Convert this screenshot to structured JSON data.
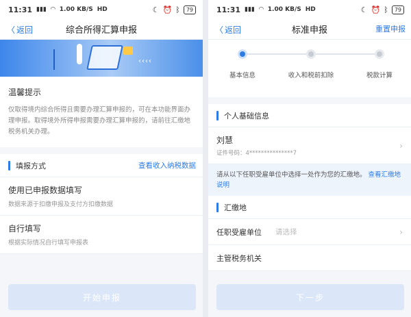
{
  "status": {
    "time": "11:31",
    "speed": "1.00\nKB/S",
    "hd": "HD",
    "battery": "79"
  },
  "left": {
    "back_label": "返回",
    "title": "综合所得汇算申报",
    "tips_title": "温馨提示",
    "tips_body": "仅取得境内综合所得且需要办理汇算申报的，可在本功能界面办理申报。取得境外所得申报需要办理汇算申报的，请前往汇缴地税务机关办理。",
    "section_label": "填报方式",
    "section_link": "查看收入纳税数据",
    "options": [
      {
        "title": "使用已申报数据填写",
        "sub": "数据来源于扣缴申报及支付方扣缴数据"
      },
      {
        "title": "自行填写",
        "sub": "根据实际情况自行填写申报表"
      }
    ],
    "button": "开始申报"
  },
  "right": {
    "back_label": "返回",
    "title": "标准申报",
    "right_link": "重置申报",
    "steps": [
      "基本信息",
      "收入和税前扣除",
      "税款计算"
    ],
    "section1": "个人基础信息",
    "person_name": "刘慧",
    "person_id": "证件号码：4***************7",
    "notice_text": "请从以下任职受雇单位中选择一处作为您的汇缴地。",
    "notice_link": "查看汇缴地说明",
    "section2": "汇缴地",
    "field1_label": "任职受雇单位",
    "field1_placeholder": "请选择",
    "field2_label": "主管税务机关",
    "button": "下一步"
  },
  "colors": {
    "accent": "#2d7be5",
    "disabled_button": "#dbe7f8"
  }
}
